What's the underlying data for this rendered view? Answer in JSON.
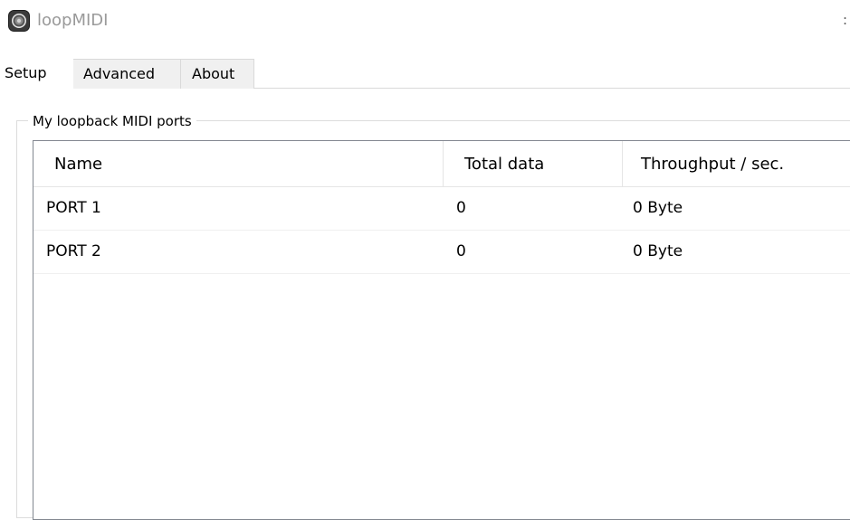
{
  "window": {
    "title": "loopMIDI",
    "icon": "loopmidi-app-icon",
    "title_edge_glyph": ":"
  },
  "tabs": [
    {
      "label": "Setup",
      "active": true
    },
    {
      "label": "Advanced",
      "active": false
    },
    {
      "label": "About",
      "active": false
    }
  ],
  "ports_group": {
    "label": "My loopback MIDI ports",
    "columns": [
      "Name",
      "Total data",
      "Throughput / sec."
    ],
    "rows": [
      {
        "name": "PORT 1",
        "total_data": "0",
        "throughput": "0 Byte"
      },
      {
        "name": "PORT 2",
        "total_data": "0",
        "throughput": "0 Byte"
      }
    ]
  },
  "colors": {
    "title_text": "#9a9a9a",
    "tab_inactive_bg": "#f0f0f0",
    "listview_border": "#828790"
  }
}
